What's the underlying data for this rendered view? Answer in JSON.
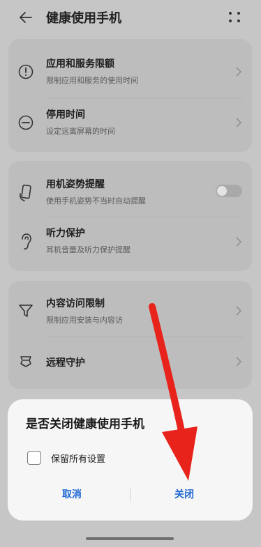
{
  "header": {
    "title": "健康使用手机",
    "back_icon": "back-arrow-icon",
    "more_icon": "more-dots-icon"
  },
  "group1": {
    "items": [
      {
        "title": "应用和服务限额",
        "subtitle": "限制应用和服务的使用时间",
        "icon": "exclamation-circle-icon"
      },
      {
        "title": "停用时间",
        "subtitle": "设定远离屏幕的时间",
        "icon": "minus-circle-icon"
      }
    ]
  },
  "group2": {
    "items": [
      {
        "title": "用机姿势提醒",
        "subtitle": "使用手机姿势不当时自动提醒",
        "icon": "phone-posture-icon",
        "toggle_on": false
      },
      {
        "title": "听力保护",
        "subtitle": "耳机音量及听力保护提醒",
        "icon": "ear-icon"
      }
    ]
  },
  "group3": {
    "items": [
      {
        "title": "内容访问限制",
        "subtitle": "限制应用安装与内容访",
        "icon": "filter-funnel-icon"
      },
      {
        "title": "远程守护",
        "icon": "remote-guard-icon"
      }
    ]
  },
  "dialog": {
    "title": "是否关闭健康使用手机",
    "checkbox_label": "保留所有设置",
    "checkbox_checked": false,
    "cancel_label": "取消",
    "confirm_label": "关闭"
  },
  "annotation": {
    "arrow_color": "#e8231b"
  }
}
